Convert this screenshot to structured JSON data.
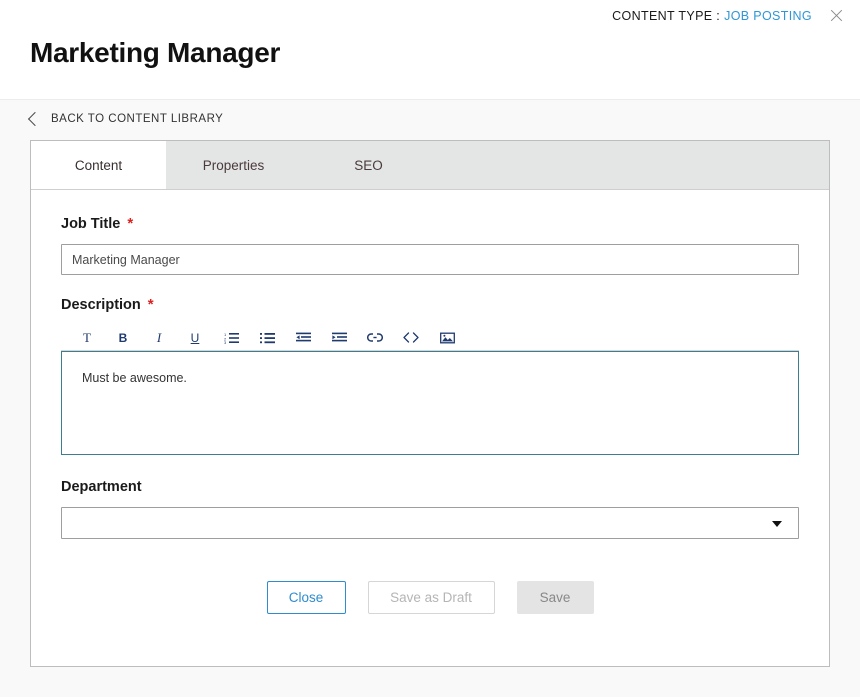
{
  "header": {
    "content_type_label": "CONTENT TYPE :",
    "content_type_value": "JOB POSTING",
    "close_icon": "close-icon",
    "title": "Marketing Manager",
    "accent_blue": "#2e97d4"
  },
  "back_nav": {
    "icon": "chevron-left-icon",
    "label": "BACK TO CONTENT LIBRARY"
  },
  "tabs": [
    {
      "label": "Content",
      "active": true
    },
    {
      "label": "Properties",
      "active": false
    },
    {
      "label": "SEO",
      "active": false
    }
  ],
  "form": {
    "job_title": {
      "label": "Job Title",
      "required_marker": "*",
      "value": "Marketing Manager",
      "placeholder": ""
    },
    "description": {
      "label": "Description",
      "required_marker": "*",
      "value": "Must be awesome.",
      "placeholder": "",
      "toolbar": [
        {
          "name": "text-style-icon",
          "glyph": "T"
        },
        {
          "name": "bold-icon",
          "glyph": "B"
        },
        {
          "name": "italic-icon",
          "glyph": "I"
        },
        {
          "name": "underline-icon",
          "glyph": "U"
        },
        {
          "name": "ordered-list-icon",
          "glyph": ""
        },
        {
          "name": "unordered-list-icon",
          "glyph": ""
        },
        {
          "name": "outdent-icon",
          "glyph": ""
        },
        {
          "name": "indent-icon",
          "glyph": ""
        },
        {
          "name": "link-icon",
          "glyph": ""
        },
        {
          "name": "code-icon",
          "glyph": ""
        },
        {
          "name": "image-icon",
          "glyph": ""
        }
      ]
    },
    "department": {
      "label": "Department",
      "selected": "",
      "options": []
    }
  },
  "buttons": {
    "close": "Close",
    "save_as_draft": "Save as Draft",
    "save": "Save"
  }
}
